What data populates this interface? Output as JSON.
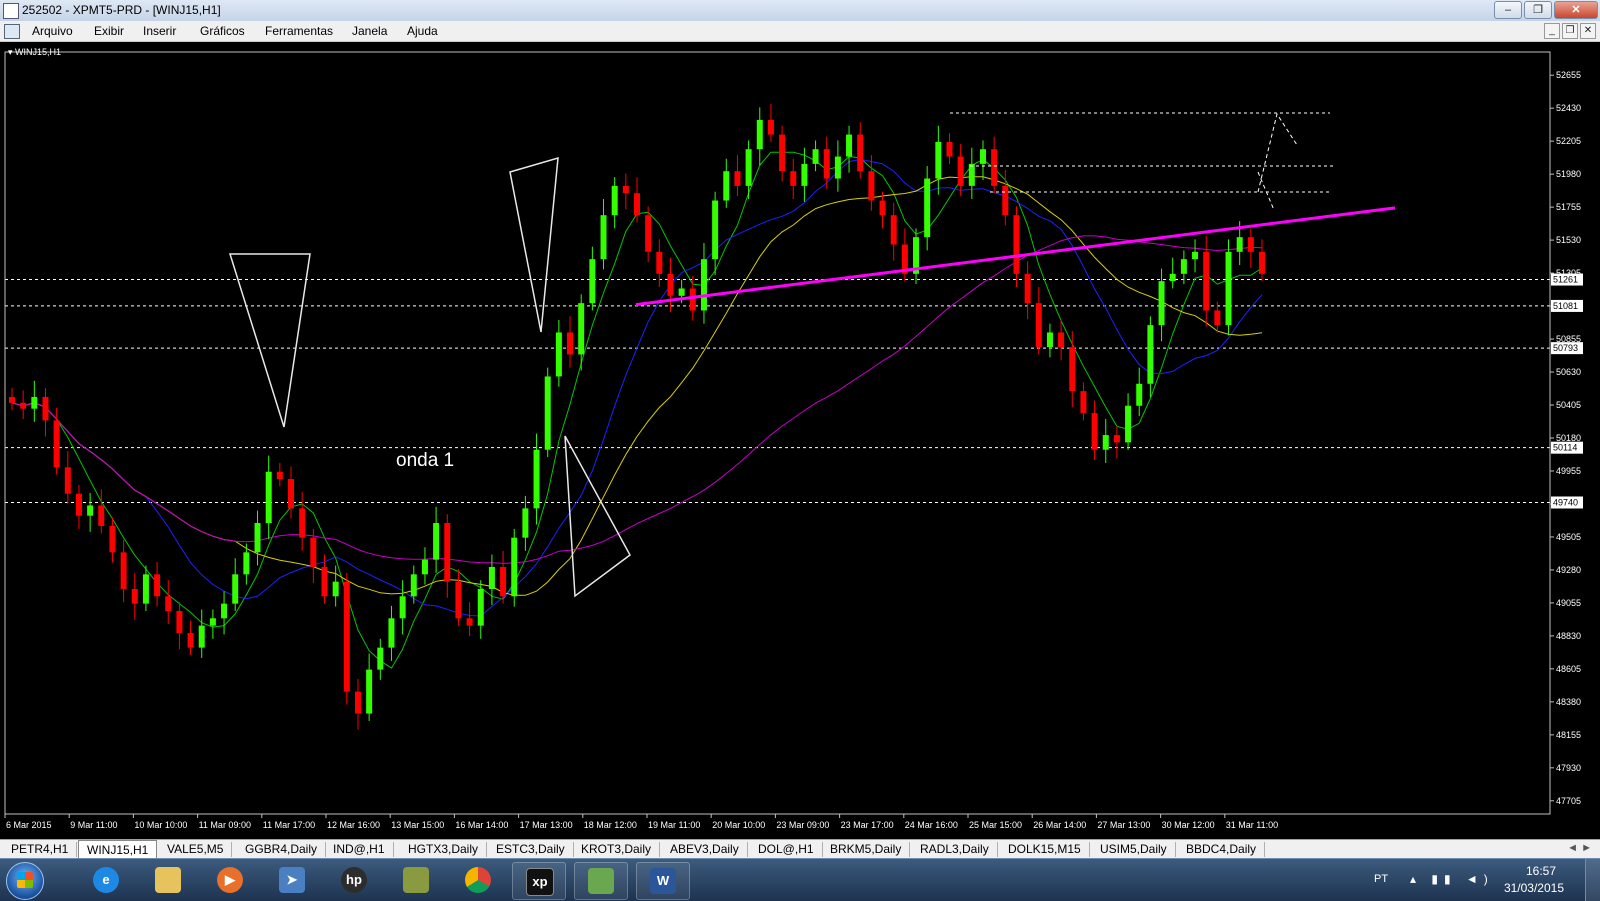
{
  "window": {
    "title": "252502 - XPMT5-PRD - [WINJ15,H1]",
    "minimize": "0",
    "maximize": "1",
    "close": "r"
  },
  "menu": {
    "items": [
      "Arquivo",
      "Exibir",
      "Inserir",
      "Gráficos",
      "Ferramentas",
      "Janela",
      "Ajuda"
    ]
  },
  "chart": {
    "symbol_label": "WINJ15,H1",
    "annotation": "onda 1"
  },
  "chart_data": {
    "type": "candlestick",
    "symbol": "WINJ15,H1",
    "y_ticks": [
      52655,
      52430,
      52205,
      51980,
      51755,
      51530,
      51305,
      51080,
      50855,
      50630,
      50405,
      50180,
      49955,
      49730,
      49505,
      49280,
      49055,
      48830,
      48605,
      48380,
      48155,
      47930,
      47705
    ],
    "ylim": [
      47615,
      52745
    ],
    "price_levels": [
      51261,
      51081,
      50793,
      50114,
      49740
    ],
    "x_labels": [
      "6 Mar 2015",
      "9 Mar 11:00",
      "10 Mar 10:00",
      "11 Mar 09:00",
      "11 Mar 17:00",
      "12 Mar 16:00",
      "13 Mar 15:00",
      "16 Mar 14:00",
      "17 Mar 13:00",
      "18 Mar 12:00",
      "19 Mar 11:00",
      "20 Mar 10:00",
      "23 Mar 09:00",
      "23 Mar 17:00",
      "24 Mar 16:00",
      "25 Mar 15:00",
      "26 Mar 14:00",
      "27 Mar 13:00",
      "30 Mar 12:00",
      "31 Mar 11:00"
    ],
    "closes": [
      50420,
      50380,
      50460,
      50300,
      49980,
      49800,
      49650,
      49720,
      49580,
      49400,
      49150,
      49050,
      49250,
      49100,
      49000,
      48850,
      48750,
      48900,
      48950,
      49050,
      49250,
      49400,
      49600,
      49950,
      49900,
      49700,
      49500,
      49300,
      49100,
      49200,
      48450,
      48300,
      48600,
      48750,
      48950,
      49100,
      49250,
      49350,
      49600,
      49200,
      48950,
      48900,
      49150,
      49300,
      49100,
      49500,
      49700,
      50100,
      50600,
      50900,
      50750,
      51100,
      51400,
      51700,
      51900,
      51850,
      51700,
      51450,
      51300,
      51150,
      51200,
      51050,
      51400,
      51800,
      52000,
      51900,
      52150,
      52350,
      52250,
      52000,
      51900,
      52050,
      52150,
      51950,
      52100,
      52250,
      52000,
      51800,
      51700,
      51500,
      51300,
      51550,
      51950,
      52200,
      52100,
      51900,
      52050,
      52150,
      51900,
      51700,
      51300,
      51100,
      50800,
      50900,
      50800,
      50500,
      50350,
      50100,
      50200,
      50150,
      50400,
      50550,
      50950,
      51250,
      51300,
      51400,
      51450,
      51050,
      50950,
      51450,
      51550,
      51450,
      51300
    ],
    "ma_green_end": 51300,
    "ma_blue_end": 51030,
    "ma_yellow_end": 51240,
    "ma_magenta_end": 50890,
    "trendline": [
      [
        51090,
        51750
      ]
    ],
    "colors": {
      "bull": "#33ff00",
      "bear": "#ff0000",
      "ma_fast": "#00c800",
      "ma_mid": "#2020ff",
      "ma_slow": "#d8d000",
      "ma_long": "#c800c8",
      "trendline": "#ff00ff",
      "grid_level": "#ffffff"
    }
  },
  "tabs": [
    "PETR4,H1",
    "WINJ15,H1",
    "VALE5,M5",
    "GGBR4,Daily",
    "IND@,H1",
    "HGTX3,Daily",
    "ESTC3,Daily",
    "KROT3,Daily",
    "ABEV3,Daily",
    "DOL@,H1",
    "BRKM5,Daily",
    "RADL3,Daily",
    "DOLK15,M15",
    "USIM5,Daily",
    "BBDC4,Daily"
  ],
  "taskbar": {
    "apps": [
      "ie-icon",
      "explorer-icon",
      "media-player-icon",
      "remote-icon",
      "hp-icon",
      "archive-icon",
      "chrome-icon",
      "xp-icon",
      "metatrader-icon",
      "word-icon"
    ],
    "xp_label": "xp",
    "word_label": "W",
    "hp_label": "hp"
  },
  "tray": {
    "lang": "PT",
    "time": "16:57",
    "date": "31/03/2015"
  }
}
